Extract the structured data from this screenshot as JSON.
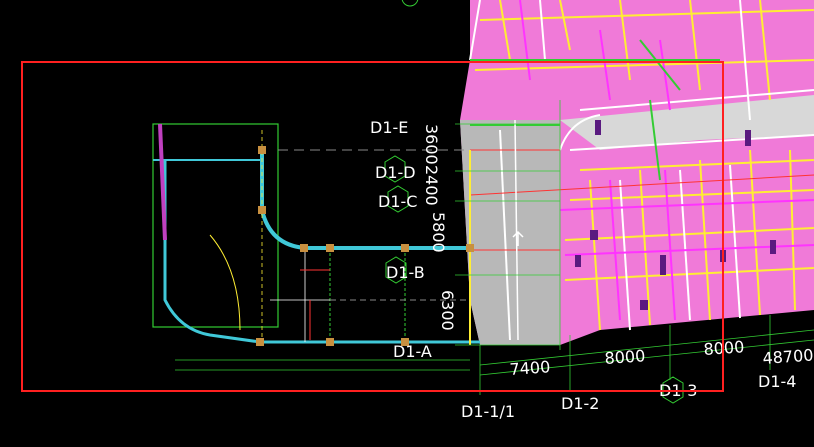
{
  "colors": {
    "background": "#000000",
    "magenta_fill": "#f07ad8",
    "yellow_lines": "#ffee33",
    "white_lines": "#ffffff",
    "magenta_lines": "#ff33ff",
    "green_lines": "#33cc33",
    "cyan_walls": "#40c8d8",
    "gray_fill": "#b8b8b8",
    "red_lines": "#ff3333",
    "selection_box": "#ff2020"
  },
  "axes": {
    "grid_row": [
      "D1-E",
      "D1-D",
      "D1-C",
      "D1-B",
      "D1-A"
    ],
    "grid_col": [
      "D1-1/1",
      "D1-2",
      "D1-3",
      "D1-4"
    ]
  },
  "dimensions": {
    "vertical": [
      "3600",
      "2400",
      "5800",
      "6300"
    ],
    "horizontal": [
      "7400",
      "8000",
      "8000",
      "48700"
    ]
  }
}
